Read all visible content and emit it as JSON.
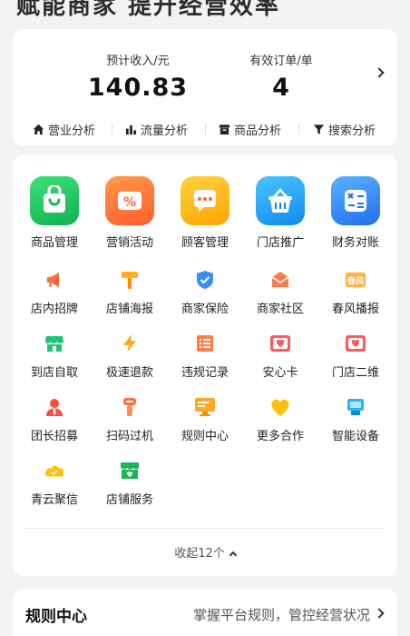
{
  "banner": {
    "text": "赋能商家 提升经营效率"
  },
  "stats": {
    "income_label": "预计收入/元",
    "income_value": "140.83",
    "orders_label": "有效订单/单",
    "orders_value": "4"
  },
  "analytics": [
    {
      "label": "营业分析",
      "icon": "home-icon"
    },
    {
      "label": "流量分析",
      "icon": "bar-chart-icon"
    },
    {
      "label": "商品分析",
      "icon": "box-icon"
    },
    {
      "label": "搜索分析",
      "icon": "filter-icon"
    }
  ],
  "grid": {
    "row1": [
      {
        "label": "商品管理",
        "icon": "shopping-bag-icon"
      },
      {
        "label": "营销活动",
        "icon": "percent-coupon-icon"
      },
      {
        "label": "顾客管理",
        "icon": "chat-bubble-icon"
      },
      {
        "label": "门店推广",
        "icon": "basket-icon"
      },
      {
        "label": "财务对账",
        "icon": "calculator-icon"
      }
    ],
    "small": [
      {
        "label": "店内招牌",
        "icon": "megaphone-icon"
      },
      {
        "label": "店铺海报",
        "icon": "paint-roller-icon"
      },
      {
        "label": "商家保险",
        "icon": "shield-check-icon"
      },
      {
        "label": "商家社区",
        "icon": "community-envelope-icon"
      },
      {
        "label": "春风播报",
        "icon": "spring-news-icon",
        "icon_text": "春风"
      },
      {
        "label": "到店自取",
        "icon": "storefront-icon"
      },
      {
        "label": "极速退款",
        "icon": "lightning-icon"
      },
      {
        "label": "违规记录",
        "icon": "list-record-icon"
      },
      {
        "label": "安心卡",
        "icon": "heart-card-icon"
      },
      {
        "label": "门店二维",
        "icon": "qr-heart-card-icon"
      },
      {
        "label": "团长招募",
        "icon": "leader-person-icon"
      },
      {
        "label": "扫码过机",
        "icon": "scanner-icon"
      },
      {
        "label": "规则中心",
        "icon": "monitor-icon"
      },
      {
        "label": "更多合作",
        "icon": "heart-icon"
      },
      {
        "label": "智能设备",
        "icon": "smart-device-icon"
      },
      {
        "label": "青云聚信",
        "icon": "cloud-icon"
      },
      {
        "label": "店铺服务",
        "icon": "shop-service-icon"
      }
    ]
  },
  "collapse": {
    "label": "收起12个"
  },
  "rules": {
    "title": "规则中心",
    "desc": "掌握平台规则，管控经营状况"
  }
}
